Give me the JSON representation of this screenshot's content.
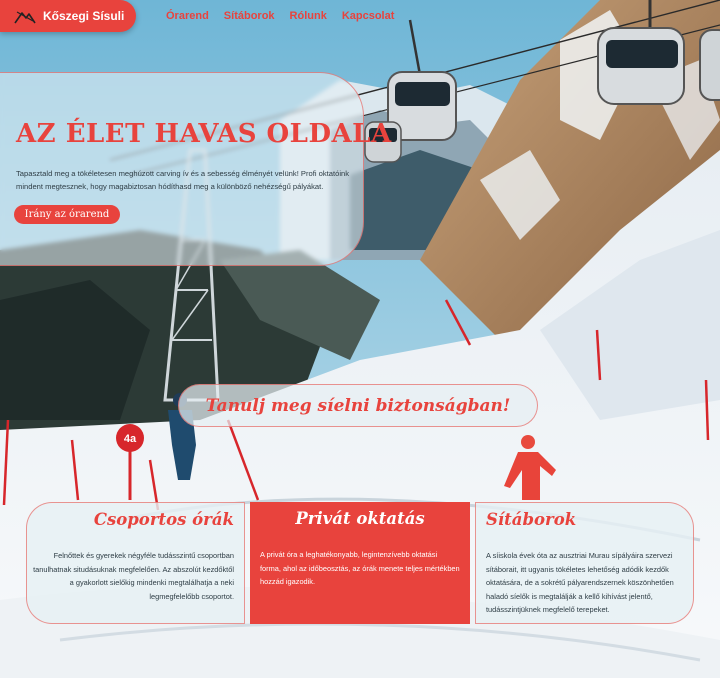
{
  "header": {
    "brand": "Kőszegi Sísuli",
    "nav": [
      "Órarend",
      "Sítáborok",
      "Rólunk",
      "Kapcsolat"
    ]
  },
  "hero": {
    "title": "AZ ÉLET HAVAS OLDALA",
    "text": "Tapasztald meg a tökéletesen meghúzott carving ív és a sebesség élményét velünk! Profi oktatóink mindent megtesznek, hogy magabiztosan hódíthasd meg a különböző nehézségű pályákat.",
    "cta": "Irány az órarend"
  },
  "tagline": "Tanulj meg síelni biztonságban!",
  "cards": [
    {
      "title": "Csoportos órák",
      "text": "Felnőttek és gyerekek négyféle tudásszintű csoportban tanulhatnak situdásuknak megfelelően. Az abszolút kezdőktől a gyakorlott sielőkig mindenki megtalálhatja a neki legmegfelelőbb csoportot."
    },
    {
      "title": "Privát oktatás",
      "text": "A privát óra a leghatékonyabb, legintenzívebb oktatási forma, ahol az időbeosztás, az órák menete teljes mértékben hozzád igazodik."
    },
    {
      "title": "Sítáborok",
      "text": "A síiskola évek óta az ausztriai Murau sípályáira szervezi sítáborait, itt ugyanis tökéletes lehetőség adódik kezdők oktatására, de a sokrétű pályarendszernek köszönhetően haladó síelők is megtalálják a kellő kihívást jelentő, tudásszintjüknek megfelelő terepeket."
    }
  ],
  "scene": {
    "sign_label": "4a"
  },
  "colors": {
    "accent": "#e8433d",
    "text": "#2e3d45"
  }
}
